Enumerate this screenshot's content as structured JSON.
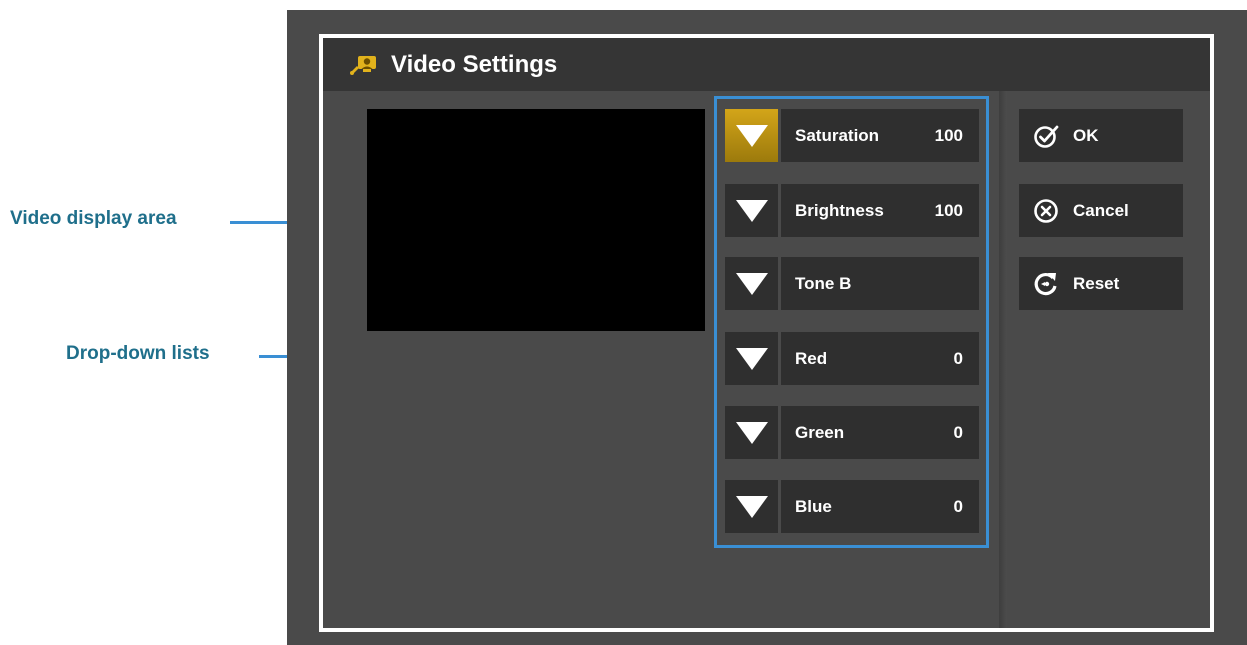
{
  "annotations": {
    "video_display": "Video display area",
    "dropdowns": "Drop-down lists"
  },
  "window": {
    "title": "Video Settings",
    "title_icon": "video-settings-icon"
  },
  "dropdowns": [
    {
      "label": "Saturation",
      "value": "100",
      "active": true
    },
    {
      "label": "Brightness",
      "value": "100",
      "active": false
    },
    {
      "label": "Tone B",
      "value": "",
      "active": false
    },
    {
      "label": "Red",
      "value": "0",
      "active": false
    },
    {
      "label": "Green",
      "value": "0",
      "active": false
    },
    {
      "label": "Blue",
      "value": "0",
      "active": false
    }
  ],
  "buttons": {
    "ok": {
      "label": "OK",
      "icon": "check-circle-icon"
    },
    "cancel": {
      "label": "Cancel",
      "icon": "x-circle-icon"
    },
    "reset": {
      "label": "Reset",
      "icon": "reset-icon"
    }
  },
  "colors": {
    "accent": "#3a8fd4",
    "active_arrow": "#c9990f",
    "annotation_text": "#1f6f8b"
  }
}
